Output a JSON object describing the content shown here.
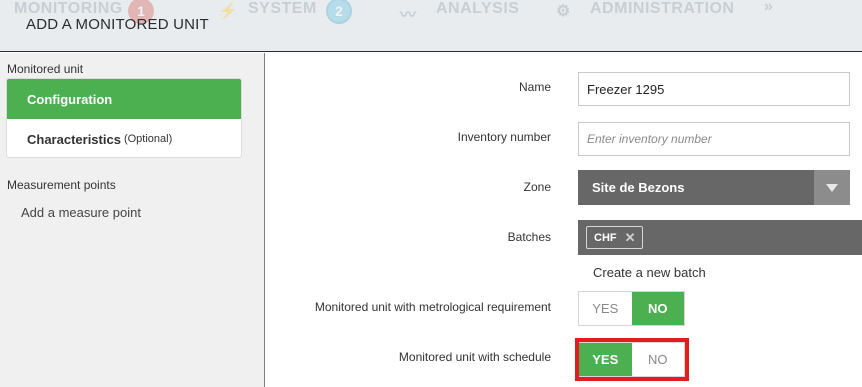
{
  "header": {
    "title": "ADD A MONITORED UNIT",
    "nav": {
      "monitoring_label": "MONITORING",
      "monitoring_badge": "1",
      "system_label": "SYSTEM",
      "system_badge": "2",
      "analysis_label": "ANALYSIS",
      "administration_label": "ADMINISTRATION",
      "more_label": "»"
    }
  },
  "sidebar": {
    "section1_heading": "Monitored unit",
    "items": [
      {
        "label": "Configuration",
        "active": true
      },
      {
        "label": "Characteristics",
        "suffix": "(Optional)",
        "active": false
      }
    ],
    "section2_heading": "Measurement points",
    "add_link": "Add a measure point"
  },
  "form": {
    "name": {
      "label": "Name",
      "value": "Freezer 1295"
    },
    "inventory": {
      "label": "Inventory number",
      "placeholder": "Enter inventory number"
    },
    "zone": {
      "label": "Zone",
      "value": "Site de Bezons"
    },
    "batches": {
      "label": "Batches",
      "tags": [
        "CHF"
      ],
      "create_link": "Create a new batch"
    },
    "metrological": {
      "label": "Monitored unit with metrological requirement",
      "yes": "YES",
      "no": "NO",
      "selected": "NO"
    },
    "schedule": {
      "label": "Monitored unit with schedule",
      "yes": "YES",
      "no": "NO",
      "selected": "YES"
    }
  },
  "colors": {
    "accent_green": "#4cb050",
    "select_gray": "#676767",
    "highlight_red": "#e31c1c"
  }
}
